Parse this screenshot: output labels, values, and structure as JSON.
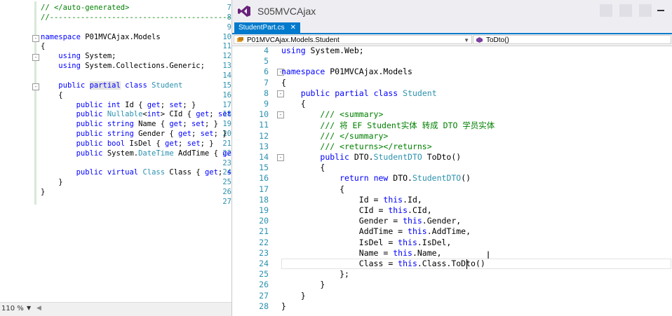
{
  "left_editor": {
    "lines": [
      {
        "n": "7",
        "segs": [
          [
            "cm",
            "// </auto-generated>"
          ]
        ]
      },
      {
        "n": "8",
        "segs": [
          [
            "cm",
            "//------------------------------------------------------------------------------"
          ]
        ]
      },
      {
        "n": "9",
        "segs": []
      },
      {
        "n": "10",
        "fold": "-",
        "segs": [
          [
            "kw",
            "namespace"
          ],
          [
            "tx",
            " P01MVCAjax.Models"
          ]
        ]
      },
      {
        "n": "11",
        "segs": [
          [
            "tx",
            "{"
          ]
        ]
      },
      {
        "n": "12",
        "fold": "-",
        "segs": [
          [
            "tx",
            "    "
          ],
          [
            "kw",
            "using"
          ],
          [
            "tx",
            " System;"
          ]
        ]
      },
      {
        "n": "13",
        "segs": [
          [
            "tx",
            "    "
          ],
          [
            "kw",
            "using"
          ],
          [
            "tx",
            " System.Collections.Generic;"
          ]
        ]
      },
      {
        "n": "14",
        "segs": []
      },
      {
        "n": "15",
        "fold": "-",
        "segs": [
          [
            "tx",
            "    "
          ],
          [
            "kw",
            "public"
          ],
          [
            "tx",
            " "
          ],
          [
            "kwhl",
            "partial"
          ],
          [
            "tx",
            " "
          ],
          [
            "kw",
            "class"
          ],
          [
            "tx",
            " "
          ],
          [
            "ty",
            "Student"
          ]
        ]
      },
      {
        "n": "16",
        "segs": [
          [
            "tx",
            "    {"
          ]
        ]
      },
      {
        "n": "17",
        "segs": [
          [
            "tx",
            "        "
          ],
          [
            "kw",
            "public"
          ],
          [
            "tx",
            " "
          ],
          [
            "kw",
            "int"
          ],
          [
            "tx",
            " Id { "
          ],
          [
            "kw",
            "get"
          ],
          [
            "tx",
            "; "
          ],
          [
            "kw",
            "set"
          ],
          [
            "tx",
            "; }"
          ]
        ]
      },
      {
        "n": "18",
        "segs": [
          [
            "tx",
            "        "
          ],
          [
            "kw",
            "public"
          ],
          [
            "tx",
            " "
          ],
          [
            "ty",
            "Nullable"
          ],
          [
            "tx",
            "<"
          ],
          [
            "kw",
            "int"
          ],
          [
            "tx",
            "> CId { "
          ],
          [
            "kw",
            "get"
          ],
          [
            "tx",
            "; "
          ],
          [
            "kw",
            "set"
          ],
          [
            "tx",
            "; }"
          ]
        ]
      },
      {
        "n": "19",
        "segs": [
          [
            "tx",
            "        "
          ],
          [
            "kw",
            "public"
          ],
          [
            "tx",
            " "
          ],
          [
            "kw",
            "string"
          ],
          [
            "tx",
            " Name { "
          ],
          [
            "kw",
            "get"
          ],
          [
            "tx",
            "; "
          ],
          [
            "kw",
            "set"
          ],
          [
            "tx",
            "; }"
          ]
        ]
      },
      {
        "n": "20",
        "segs": [
          [
            "tx",
            "        "
          ],
          [
            "kw",
            "public"
          ],
          [
            "tx",
            " "
          ],
          [
            "kw",
            "string"
          ],
          [
            "tx",
            " Gender { "
          ],
          [
            "kw",
            "get"
          ],
          [
            "tx",
            "; "
          ],
          [
            "kw",
            "set"
          ],
          [
            "tx",
            "; }"
          ]
        ]
      },
      {
        "n": "21",
        "segs": [
          [
            "tx",
            "        "
          ],
          [
            "kw",
            "public"
          ],
          [
            "tx",
            " "
          ],
          [
            "kw",
            "bool"
          ],
          [
            "tx",
            " IsDel { "
          ],
          [
            "kw",
            "get"
          ],
          [
            "tx",
            "; "
          ],
          [
            "kw",
            "set"
          ],
          [
            "tx",
            "; }"
          ]
        ]
      },
      {
        "n": "22",
        "segs": [
          [
            "tx",
            "        "
          ],
          [
            "kw",
            "public"
          ],
          [
            "tx",
            " System."
          ],
          [
            "ty",
            "DateTime"
          ],
          [
            "tx",
            " AddTime { "
          ],
          [
            "kw",
            "get"
          ],
          [
            "tx",
            "; s"
          ]
        ]
      },
      {
        "n": "23",
        "segs": []
      },
      {
        "n": "24",
        "segs": [
          [
            "tx",
            "        "
          ],
          [
            "kw",
            "public"
          ],
          [
            "tx",
            " "
          ],
          [
            "kw",
            "virtual"
          ],
          [
            "tx",
            " "
          ],
          [
            "ty",
            "Class"
          ],
          [
            "tx",
            " Class { "
          ],
          [
            "kw",
            "get"
          ],
          [
            "tx",
            "; "
          ],
          [
            "kw",
            "set"
          ],
          [
            "tx",
            ";"
          ]
        ]
      },
      {
        "n": "25",
        "segs": [
          [
            "tx",
            "    }"
          ]
        ]
      },
      {
        "n": "26",
        "segs": [
          [
            "tx",
            "}"
          ]
        ]
      },
      {
        "n": "27",
        "segs": []
      }
    ],
    "zoom": "110 %"
  },
  "window": {
    "title": "S05MVCAjax",
    "tab_label": "StudentPart.cs",
    "tab_close": "✕",
    "nav_left": "P01MVCAjax.Models.Student",
    "nav_right": "ToDto()"
  },
  "right_editor": {
    "lines": [
      {
        "n": "4",
        "segs": [
          [
            "kw",
            "using"
          ],
          [
            "tx",
            " System.Web;"
          ]
        ]
      },
      {
        "n": "5",
        "segs": []
      },
      {
        "n": "6",
        "fold": "-",
        "segs": [
          [
            "kw",
            "namespace"
          ],
          [
            "tx",
            " P01MVCAjax.Models"
          ]
        ]
      },
      {
        "n": "7",
        "segs": [
          [
            "tx",
            "{"
          ]
        ]
      },
      {
        "n": "8",
        "fold": "-",
        "segs": [
          [
            "tx",
            "    "
          ],
          [
            "kw",
            "public"
          ],
          [
            "tx",
            " "
          ],
          [
            "kw",
            "partial"
          ],
          [
            "tx",
            " "
          ],
          [
            "kw",
            "class"
          ],
          [
            "tx",
            " "
          ],
          [
            "ty",
            "Student"
          ]
        ]
      },
      {
        "n": "9",
        "segs": [
          [
            "tx",
            "    {"
          ]
        ]
      },
      {
        "n": "10",
        "fold": "-",
        "segs": [
          [
            "tx",
            "        "
          ],
          [
            "cm",
            "/// <summary>"
          ]
        ]
      },
      {
        "n": "11",
        "segs": [
          [
            "tx",
            "        "
          ],
          [
            "cm",
            "/// 将 EF Student实体 转成 DTO 学员实体"
          ]
        ]
      },
      {
        "n": "12",
        "segs": [
          [
            "tx",
            "        "
          ],
          [
            "cm",
            "/// </summary>"
          ]
        ]
      },
      {
        "n": "13",
        "segs": [
          [
            "tx",
            "        "
          ],
          [
            "cm",
            "/// <returns></returns>"
          ]
        ]
      },
      {
        "n": "14",
        "fold": "-",
        "segs": [
          [
            "tx",
            "        "
          ],
          [
            "kw",
            "public"
          ],
          [
            "tx",
            " DTO."
          ],
          [
            "ty",
            "StudentDTO"
          ],
          [
            "tx",
            " ToDto()"
          ]
        ]
      },
      {
        "n": "15",
        "segs": [
          [
            "tx",
            "        {"
          ]
        ]
      },
      {
        "n": "16",
        "segs": [
          [
            "tx",
            "            "
          ],
          [
            "kw",
            "return"
          ],
          [
            "tx",
            " "
          ],
          [
            "kw",
            "new"
          ],
          [
            "tx",
            " DTO."
          ],
          [
            "ty",
            "StudentDTO"
          ],
          [
            "tx",
            "()"
          ]
        ]
      },
      {
        "n": "17",
        "segs": [
          [
            "tx",
            "            {"
          ]
        ]
      },
      {
        "n": "18",
        "segs": [
          [
            "tx",
            "                Id = "
          ],
          [
            "kw",
            "this"
          ],
          [
            "tx",
            ".Id,"
          ]
        ]
      },
      {
        "n": "19",
        "segs": [
          [
            "tx",
            "                CId = "
          ],
          [
            "kw",
            "this"
          ],
          [
            "tx",
            ".CId,"
          ]
        ]
      },
      {
        "n": "20",
        "segs": [
          [
            "tx",
            "                Gender = "
          ],
          [
            "kw",
            "this"
          ],
          [
            "tx",
            ".Gender,"
          ]
        ]
      },
      {
        "n": "21",
        "segs": [
          [
            "tx",
            "                AddTime = "
          ],
          [
            "kw",
            "this"
          ],
          [
            "tx",
            ".AddTime,"
          ]
        ]
      },
      {
        "n": "22",
        "segs": [
          [
            "tx",
            "                IsDel = "
          ],
          [
            "kw",
            "this"
          ],
          [
            "tx",
            ".IsDel,"
          ]
        ]
      },
      {
        "n": "23",
        "segs": [
          [
            "tx",
            "                Name = "
          ],
          [
            "kw",
            "this"
          ],
          [
            "tx",
            ".Name,"
          ]
        ]
      },
      {
        "n": "24",
        "segs": [
          [
            "tx",
            "                Class = "
          ],
          [
            "kw",
            "this"
          ],
          [
            "tx",
            ".Class.ToDto()"
          ]
        ]
      },
      {
        "n": "25",
        "segs": [
          [
            "tx",
            "            };"
          ]
        ]
      },
      {
        "n": "26",
        "segs": [
          [
            "tx",
            "        }"
          ]
        ]
      },
      {
        "n": "27",
        "segs": [
          [
            "tx",
            "    }"
          ]
        ]
      },
      {
        "n": "28",
        "segs": [
          [
            "tx",
            "}"
          ]
        ]
      }
    ]
  },
  "colors": {
    "accent": "#007acc",
    "keyword": "#0000ff",
    "type": "#2b91af",
    "comment": "#008000"
  }
}
